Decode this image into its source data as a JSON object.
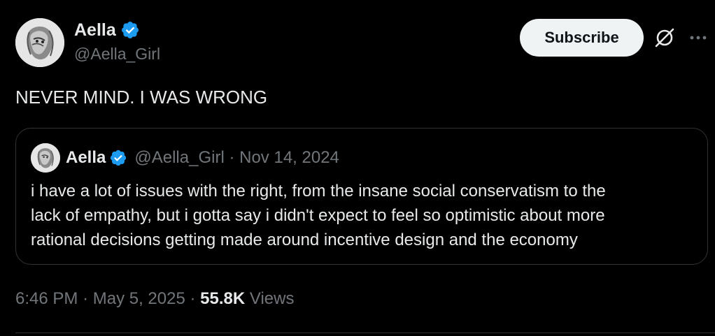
{
  "author": {
    "display_name": "Aella",
    "handle": "@Aella_Girl"
  },
  "actions": {
    "subscribe_label": "Subscribe",
    "grok_icon": "grok-icon",
    "more_icon": "more-horizontal-icon"
  },
  "tweet": {
    "text": "NEVER MIND. I WAS WRONG"
  },
  "quote": {
    "display_name": "Aella",
    "handle": "@Aella_Girl",
    "separator": "·",
    "date": "Nov 14, 2024",
    "lines": [
      "i have a lot of issues with the right, from the insane social conservatism to the",
      "lack of empathy, but i gotta say i didn't expect to feel so optimistic about more",
      "rational decisions getting made around incentive design and the economy"
    ]
  },
  "footer": {
    "time": "6:46 PM",
    "separator": "·",
    "date": "May 5, 2025",
    "views_count": "55.8K",
    "views_label": "Views"
  },
  "colors": {
    "background": "#000000",
    "text_primary": "#e7e9ea",
    "text_secondary": "#71767b",
    "verified_blue": "#1d9bf0",
    "border": "#2f3336",
    "button_bg": "#eff3f4"
  }
}
